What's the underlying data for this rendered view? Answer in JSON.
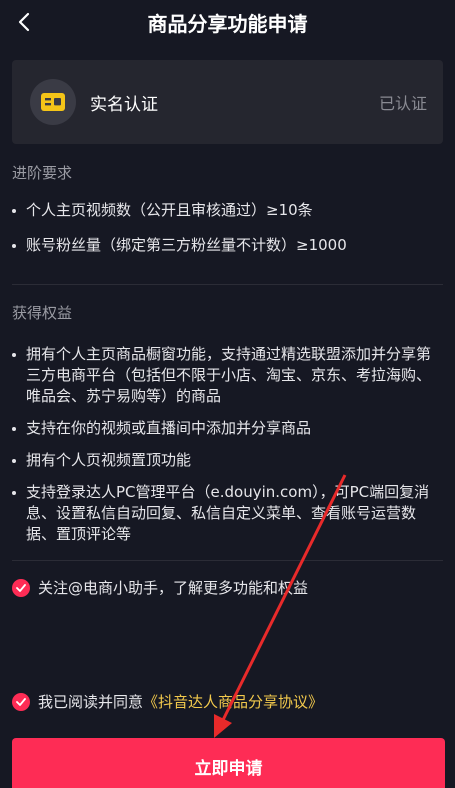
{
  "header": {
    "title": "商品分享功能申请",
    "back_icon": "chevron-left-icon"
  },
  "verify_card": {
    "label": "实名认证",
    "status": "已认证",
    "icon": "id-card-icon"
  },
  "requirements": {
    "title": "进阶要求",
    "items": [
      "个人主页视频数（公开且审核通过）≥10条",
      "账号粉丝量（绑定第三方粉丝量不计数）≥1000"
    ]
  },
  "benefits": {
    "title": "获得权益",
    "items": [
      "拥有个人主页商品橱窗功能，支持通过精选联盟添加并分享第三方电商平台（包括但不限于小店、淘宝、京东、考拉海购、唯品会、苏宁易购等）的商品",
      "支持在你的视频或直播间中添加并分享商品",
      "拥有个人页视频置顶功能",
      "支持登录达人PC管理平台（e.douyin.com），可PC端回复消息、设置私信自动回复、私信自定义菜单、查看账号运营数据、置顶评论等"
    ]
  },
  "follow_check": {
    "text": "关注@电商小助手，了解更多功能和权益",
    "checked": true
  },
  "agree_check": {
    "text": "我已阅读并同意",
    "link": "《抖音达人商品分享协议》",
    "checked": true
  },
  "apply_button": {
    "label": "立即申请"
  },
  "colors": {
    "accent": "#fe2c55",
    "link": "#f2c94c",
    "background": "#161823",
    "card": "#25262f"
  }
}
